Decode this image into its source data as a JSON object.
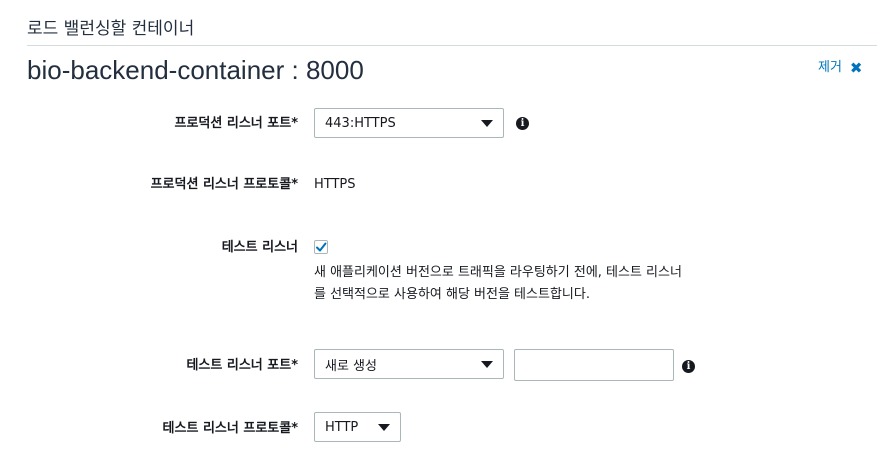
{
  "section": {
    "title": "로드 밸런싱할 컨테이너"
  },
  "container": {
    "title": "bio-backend-container : 8000",
    "remove_label": "제거",
    "remove_icon": "close-icon"
  },
  "production_listener_port": {
    "label": "프로덕션 리스너 포트*",
    "value": "443:HTTPS",
    "info_icon": "info-icon"
  },
  "production_listener_protocol": {
    "label": "프로덕션 리스너 프로토콜*",
    "value": "HTTPS"
  },
  "test_listener": {
    "label": "테스트 리스너",
    "checked": true,
    "help_line1": "새 애플리케이션 버전으로 트래픽을 라우팅하기 전에, 테스트 리스너",
    "help_line2": "를 선택적으로 사용하여 해당 버전을 테스트합니다."
  },
  "test_listener_port": {
    "label": "테스트 리스너 포트*",
    "value": "새로 생성",
    "input_value": "",
    "info_icon": "info-icon"
  },
  "test_listener_protocol": {
    "label": "테스트 리스너 프로토콜*",
    "value": "HTTP"
  },
  "colors": {
    "link": "#0073bb",
    "text": "#16191f",
    "border": "#aab7b8",
    "rule": "#d5dbdb"
  }
}
